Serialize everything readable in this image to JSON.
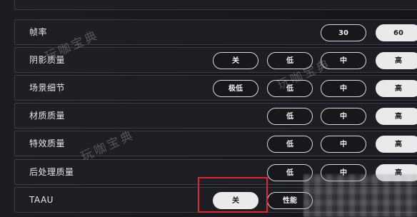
{
  "settings": {
    "rows": [
      {
        "label": "帧率",
        "options": [
          "30",
          "60"
        ]
      },
      {
        "label": "阴影质量",
        "options": [
          "关",
          "低",
          "中",
          "高"
        ]
      },
      {
        "label": "场景细节",
        "options": [
          "极低",
          "低",
          "中",
          "高"
        ]
      },
      {
        "label": "材质质量",
        "options": [
          "低",
          "中",
          "高"
        ]
      },
      {
        "label": "特效质量",
        "options": [
          "低",
          "中",
          "高"
        ]
      },
      {
        "label": "后处理质量",
        "options": [
          "低",
          "中",
          "高"
        ]
      },
      {
        "label": "TAAU",
        "options": [
          "关",
          "性能"
        ]
      }
    ],
    "selected": {
      "frame_rate": "60",
      "shadow_quality": "高",
      "scene_detail": "高",
      "texture_quality": "高",
      "effects_quality": "高",
      "post_processing": "高",
      "taau": "关"
    }
  },
  "watermark": {
    "text": "玩咖宝典"
  },
  "colors": {
    "accent_highlight": "#e3262a",
    "selected_button": "#e9eaec",
    "background": "#16171b"
  }
}
